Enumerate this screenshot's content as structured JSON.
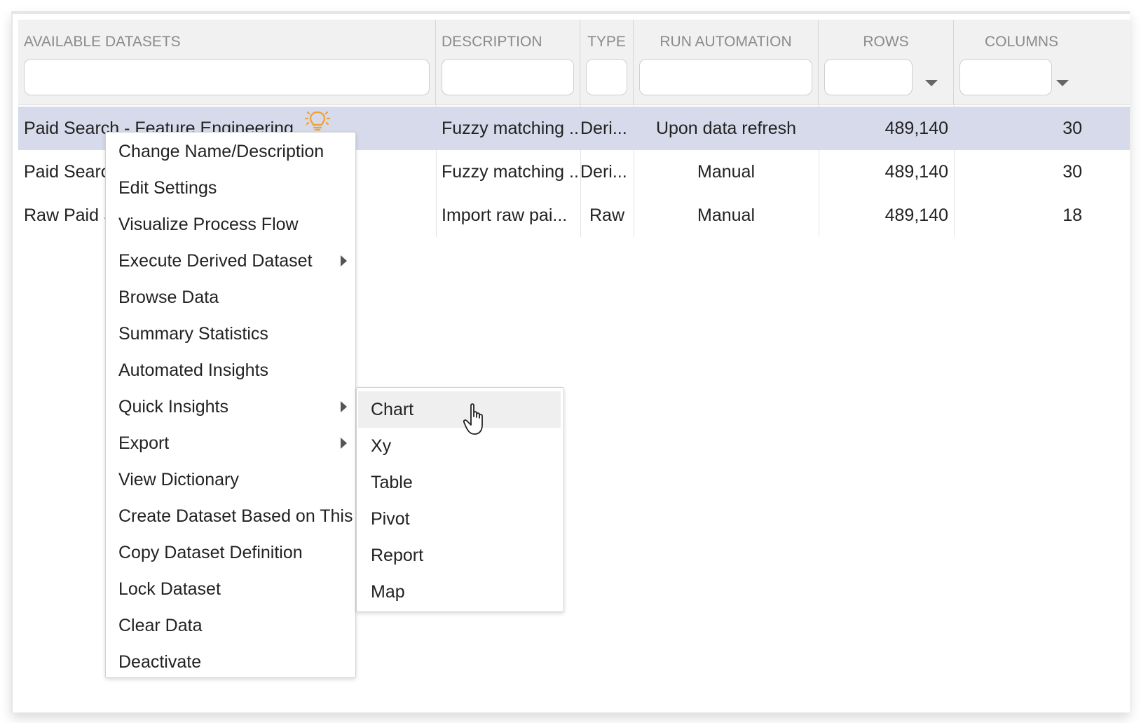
{
  "columns": [
    {
      "label": "AVAILABLE DATASETS",
      "filter": ""
    },
    {
      "label": "DESCRIPTION",
      "filter": ""
    },
    {
      "label": "TYPE",
      "filter": ""
    },
    {
      "label": "RUN AUTOMATION",
      "filter": ""
    },
    {
      "label": "ROWS",
      "filter": ""
    },
    {
      "label": "COLUMNS",
      "filter": ""
    }
  ],
  "rows": [
    {
      "name": "Paid Search - Feature Engineering",
      "description": "Fuzzy matching ...",
      "type": "Deri...",
      "automation": "Upon data refresh",
      "rows": "489,140",
      "columns": "30"
    },
    {
      "name": "Paid Search",
      "description": "Fuzzy matching ...",
      "type": "Deri...",
      "automation": "Manual",
      "rows": "489,140",
      "columns": "30"
    },
    {
      "name": "Raw Paid S",
      "description": "Import raw pai...",
      "type": "Raw",
      "automation": "Manual",
      "rows": "489,140",
      "columns": "18"
    }
  ],
  "context_menu": [
    "Change Name/Description",
    "Edit Settings",
    "Visualize Process Flow",
    "Execute Derived Dataset",
    "Browse Data",
    "Summary Statistics",
    "Automated Insights",
    "Quick Insights",
    "Export",
    "View Dictionary",
    "Create Dataset Based on This",
    "Copy Dataset Definition",
    "Lock Dataset",
    "Clear Data",
    "Deactivate"
  ],
  "submenu": [
    "Chart",
    "Xy",
    "Table",
    "Pivot",
    "Report",
    "Map"
  ],
  "icons": {
    "insight": "lightbulb-icon",
    "cursor": "hand-pointer-icon"
  },
  "colors": {
    "selected_row": "#d6daea",
    "bulb": "#f0a030"
  }
}
